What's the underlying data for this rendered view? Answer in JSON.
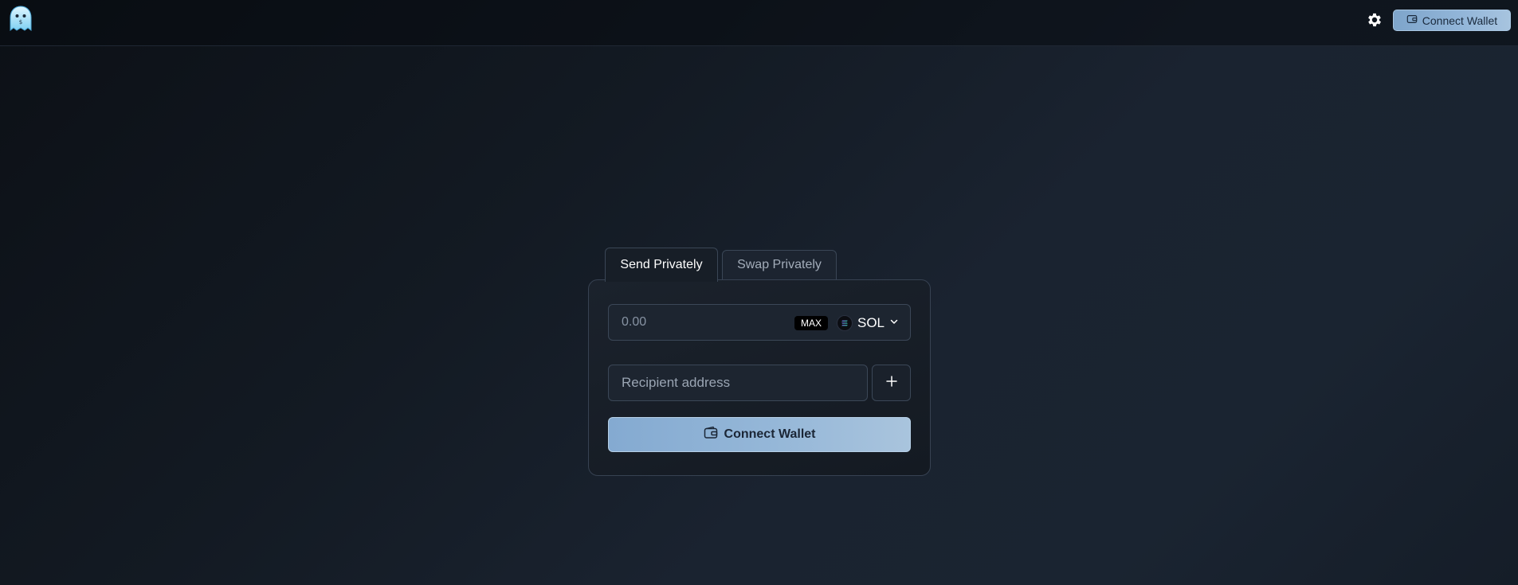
{
  "header": {
    "logo_icon": "ghost-logo-icon",
    "settings_icon": "gear-icon",
    "connect_wallet_label": "Connect Wallet"
  },
  "tabs": [
    {
      "label": "Send Privately",
      "active": true
    },
    {
      "label": "Swap Privately",
      "active": false
    }
  ],
  "send_form": {
    "amount_placeholder": "0.00",
    "max_label": "MAX",
    "token_symbol": "SOL",
    "token_icon": "solana-icon",
    "recipient_placeholder": "Recipient address",
    "add_icon": "plus-icon",
    "connect_wallet_label": "Connect Wallet"
  },
  "colors": {
    "accent": "#93b6d9",
    "background": "#151c25"
  }
}
